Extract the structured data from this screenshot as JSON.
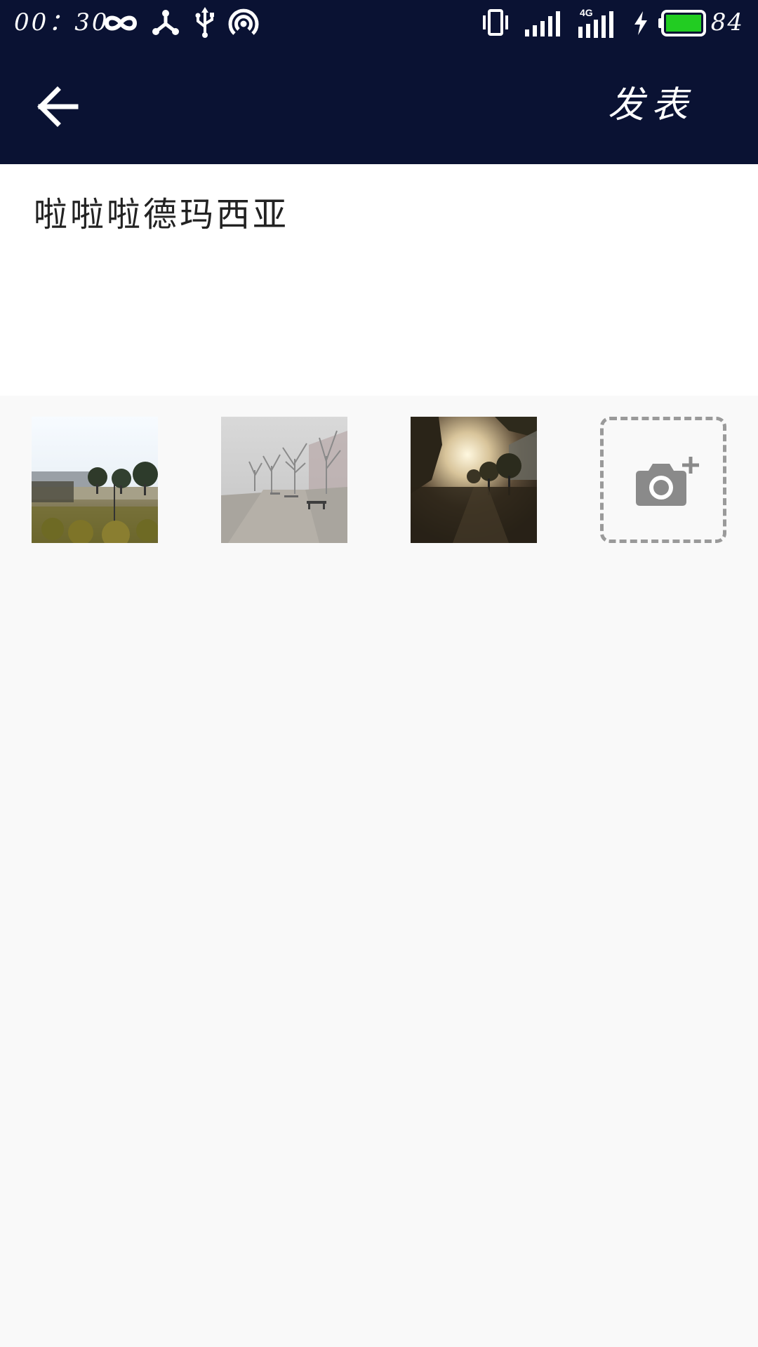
{
  "status_bar": {
    "time": "00：30",
    "battery_level": "84",
    "battery_fill_fraction": 0.84,
    "battery_color": "#22cc22",
    "icons": [
      "infinity-icon",
      "share-nodes-icon",
      "usb-icon",
      "hotspot-icon",
      "vibrate-icon",
      "signal-icon",
      "signal-4g-icon",
      "charging-bolt-icon",
      "battery-icon"
    ],
    "network_label": "4G"
  },
  "app_bar": {
    "back_icon": "arrow-left-icon",
    "publish_label": "发表",
    "background": "#0a1233"
  },
  "post": {
    "text": "啦啦啦德玛西亚"
  },
  "photos": [
    {
      "name": "photo-1",
      "scene": "park-trees"
    },
    {
      "name": "photo-2",
      "scene": "foggy-path"
    },
    {
      "name": "photo-3",
      "scene": "sunrise-trees"
    }
  ],
  "add_photo": {
    "icon": "camera-add-icon"
  }
}
